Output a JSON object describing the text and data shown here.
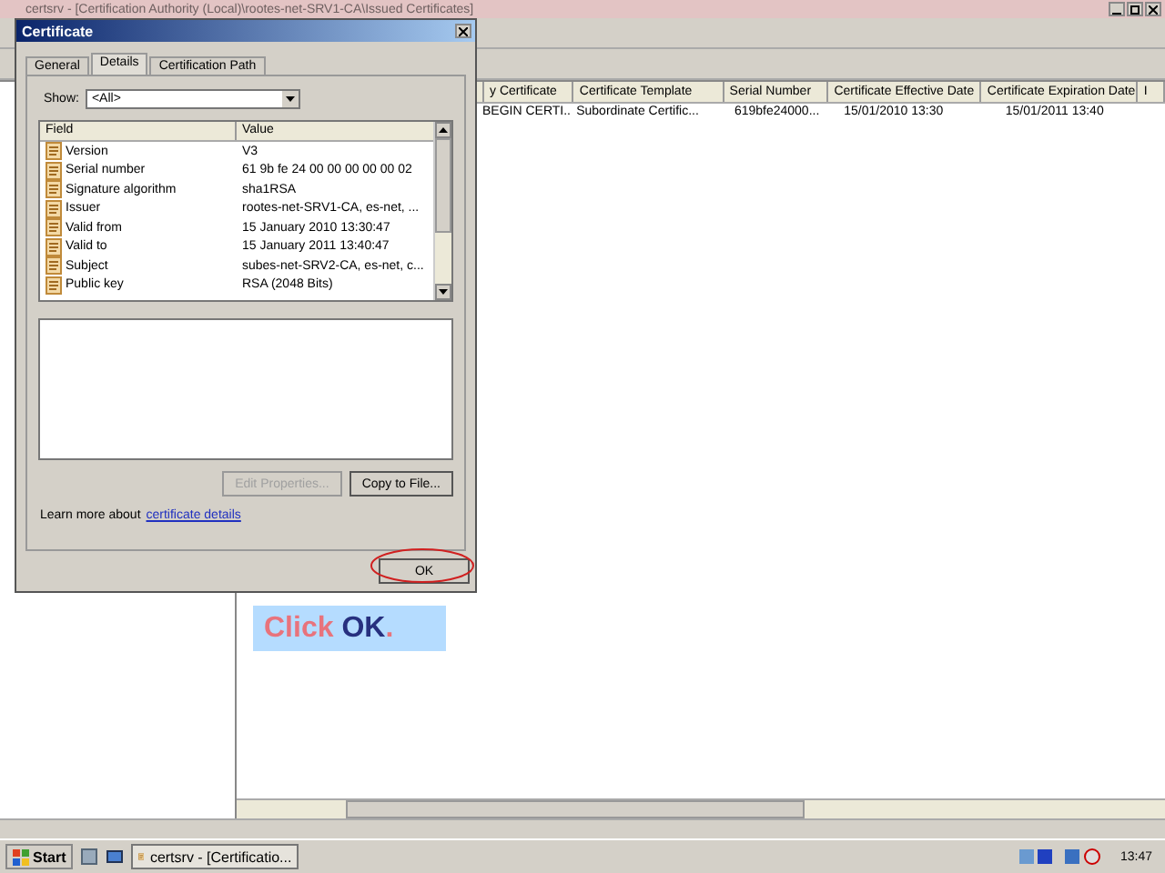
{
  "main_window": {
    "title": "certsrv - [Certification Authority (Local)\\rootes-net-SRV1-CA\\Issued Certificates]",
    "columns": [
      "y Certificate",
      "Certificate Template",
      "Serial Number",
      "Certificate Effective Date",
      "Certificate Expiration Date",
      "I"
    ],
    "rows": [
      [
        "BEGIN CERTI...",
        "Subordinate Certific...",
        "619bfe24000...",
        "15/01/2010 13:30",
        "15/01/2011 13:40"
      ]
    ]
  },
  "dialog": {
    "title": "Certificate",
    "tabs": [
      {
        "label": "General",
        "selected": false
      },
      {
        "label": "Details",
        "selected": true
      },
      {
        "label": "Certification Path",
        "selected": false
      }
    ],
    "show_label": "Show:",
    "show_value": "<All>",
    "list_columns": [
      "Field",
      "Value"
    ],
    "fields": [
      {
        "field": "Version",
        "value": "V3"
      },
      {
        "field": "Serial number",
        "value": "61 9b fe 24 00 00 00 00 00 02"
      },
      {
        "field": "Signature algorithm",
        "value": "sha1RSA"
      },
      {
        "field": "Issuer",
        "value": "rootes-net-SRV1-CA, es-net, ..."
      },
      {
        "field": "Valid from",
        "value": "15 January 2010 13:30:47"
      },
      {
        "field": "Valid to",
        "value": "15 January 2011 13:40:47"
      },
      {
        "field": "Subject",
        "value": "subes-net-SRV2-CA, es-net, c..."
      },
      {
        "field": "Public key",
        "value": "RSA (2048 Bits)"
      }
    ],
    "buttons": [
      {
        "label": "Edit Properties...",
        "disabled": true
      },
      {
        "label": "Copy to File...",
        "disabled": false
      }
    ],
    "learn_text": "Learn more about",
    "learn_link": "certificate details",
    "ok": "OK"
  },
  "callout": {
    "parts": [
      {
        "text": "Click ",
        "color": "#e8737c"
      },
      {
        "text": "OK",
        "color": "#27307f"
      },
      {
        "text": ".",
        "color": "#e8737c"
      }
    ]
  },
  "taskbar": {
    "start": "Start",
    "task": "certsrv - [Certificatio...",
    "clock": "13:47"
  }
}
